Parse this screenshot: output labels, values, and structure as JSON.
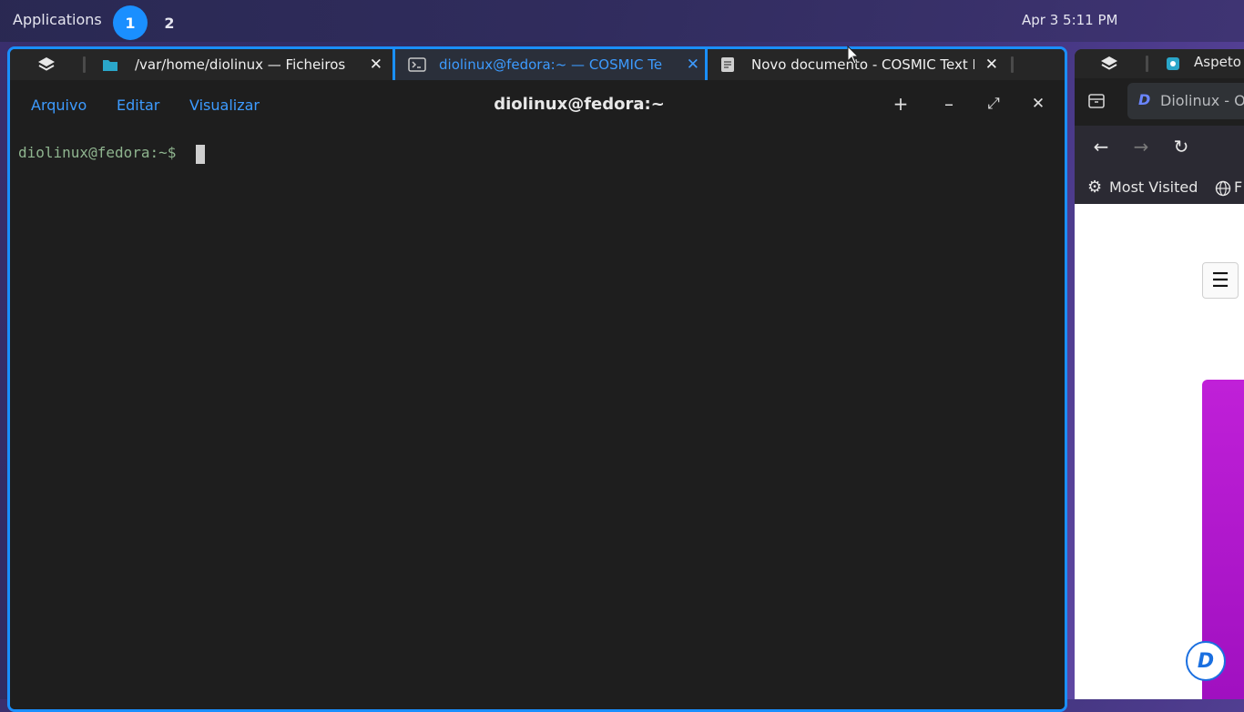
{
  "panel": {
    "applications": "Applications",
    "workspaces": [
      "1",
      "2"
    ],
    "clock": "Apr 3 5:11 PM"
  },
  "main_window": {
    "tabs": [
      {
        "label": "/var/home/diolinux — Ficheiros",
        "icon": "folder-icon",
        "active": false
      },
      {
        "label": "diolinux@fedora:~ — COSMIC Terminal",
        "icon": "terminal-icon",
        "active": true
      },
      {
        "label": "Novo documento - COSMIC Text Editor",
        "icon": "document-icon",
        "active": false
      }
    ],
    "menu": [
      "Arquivo",
      "Editar",
      "Visualizar"
    ],
    "title": "diolinux@fedora:~",
    "controls": {
      "add": "+",
      "minimize": "–",
      "maximize": "⤢",
      "close": "✕"
    },
    "terminal": {
      "prompt": "diolinux@fedora:~$"
    }
  },
  "browser": {
    "window_title": "Aspeto",
    "tab_title": "Diolinux - O",
    "bookmarks": {
      "most_visited": "Most Visited",
      "other": "F"
    }
  },
  "colors": {
    "accent": "#1a8fff",
    "terminal_bg": "#1e1e1e",
    "prompt": "#8fb58f",
    "hero": "#c020d8"
  }
}
